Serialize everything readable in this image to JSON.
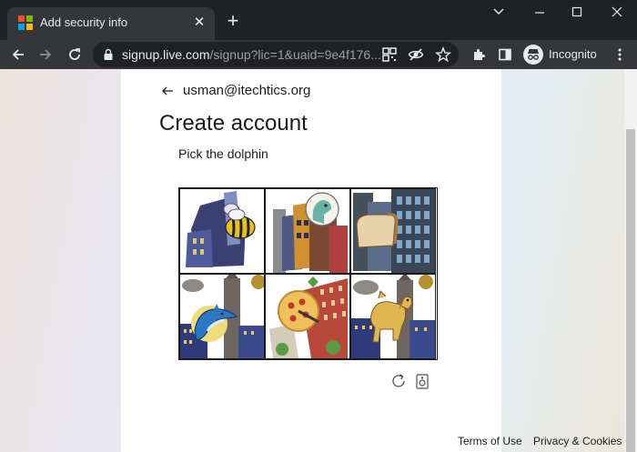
{
  "browser": {
    "tab": {
      "title": "Add security info",
      "favicon": "microsoft-logo"
    },
    "window_controls": [
      "chevron-down-icon",
      "minimize-icon",
      "maximize-icon",
      "close-icon"
    ],
    "address": {
      "host": "signup.live.com",
      "path": "/signup?lic=1&uaid=9e4f176..."
    },
    "profile": {
      "label": "Incognito"
    }
  },
  "page": {
    "back_arrow": "←",
    "email": "usman@itechtics.org",
    "title": "Create account",
    "prompt": "Pick the dolphin",
    "captcha": {
      "tiles": [
        {
          "label": "bee-on-buildings",
          "row": 0,
          "col": 0
        },
        {
          "label": "bird-on-buildings",
          "row": 0,
          "col": 1
        },
        {
          "label": "bread-on-buildings",
          "row": 0,
          "col": 2
        },
        {
          "label": "dolphin-on-buildings",
          "row": 1,
          "col": 0
        },
        {
          "label": "pizza-on-buildings",
          "row": 1,
          "col": 1
        },
        {
          "label": "dog-on-buildings",
          "row": 1,
          "col": 2
        }
      ]
    },
    "footer": {
      "terms": "Terms of Use",
      "privacy": "Privacy & Cookies"
    }
  },
  "colors": {
    "chrome_dark": "#202124",
    "chrome_toolbar": "#35363a",
    "text": "#1b1b1b"
  }
}
